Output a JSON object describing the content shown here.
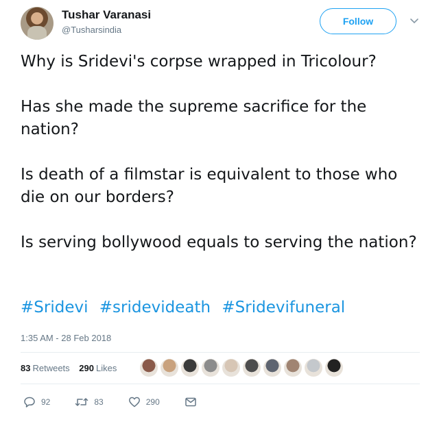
{
  "author": {
    "name": "Tushar Varanasi",
    "handle": "@Tusharsindia",
    "follow_label": "Follow"
  },
  "tweet": {
    "paragraphs": [
      "Why is Sridevi's corpse wrapped in Tricolour?",
      "Has she made the supreme sacrifice for the nation?",
      "Is death of a filmstar is equivalent to those who die on our borders?",
      "Is serving bollywood equals to  serving the nation?"
    ],
    "hashtags": [
      "#Sridevi",
      "#sridevideath",
      "#Sridevifuneral"
    ],
    "timestamp": "1:35 AM - 28 Feb 2018"
  },
  "stats": {
    "retweets_count": "83",
    "retweets_label": "Retweets",
    "likes_count": "290",
    "likes_label": "Likes",
    "liker_colors": [
      "#8a5a4a",
      "#c9a27e",
      "#3b3b3b",
      "#8c8c8c",
      "#d7c6b5",
      "#4d4d4d",
      "#5e6470",
      "#a08472",
      "#c4c8cc",
      "#222222"
    ]
  },
  "actions": {
    "reply_count": "92",
    "retweet_count": "83",
    "like_count": "290"
  },
  "colors": {
    "accent": "#1da1f2",
    "hashtag": "#1b95e0",
    "muted": "#657786"
  }
}
